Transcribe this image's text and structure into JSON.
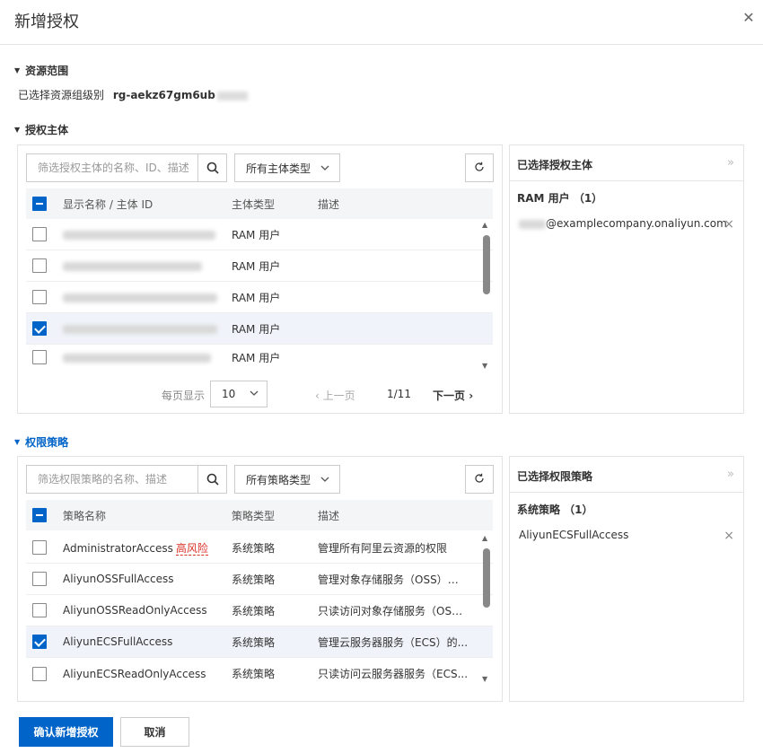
{
  "dialog": {
    "title": "新增授权"
  },
  "resource": {
    "section_title": "资源范围",
    "label": "已选择资源组级别",
    "value": "rg-aekz67gm6ub"
  },
  "principal": {
    "section_title": "授权主体",
    "search_placeholder": "筛选授权主体的名称、ID、描述",
    "type_select": "所有主体类型",
    "columns": [
      "显示名称 / 主体 ID",
      "主体类型",
      "描述"
    ],
    "rows": [
      {
        "type": "RAM 用户",
        "selected": false
      },
      {
        "type": "RAM 用户",
        "selected": false
      },
      {
        "type": "RAM 用户",
        "selected": false
      },
      {
        "type": "RAM 用户",
        "selected": true
      },
      {
        "type": "RAM 用户",
        "selected": false
      }
    ],
    "pager": {
      "page_size_label": "每页显示",
      "page_size": "10",
      "prev": "上一页",
      "count": "1/11",
      "next": "下一页"
    },
    "selected_panel": {
      "title": "已选择授权主体",
      "group": "RAM 用户 （1）",
      "item": "@examplecompany.onaliyun.com"
    }
  },
  "policy": {
    "section_title": "权限策略",
    "search_placeholder": "筛选权限策略的名称、描述",
    "type_select": "所有策略类型",
    "columns": [
      "策略名称",
      "策略类型",
      "描述"
    ],
    "risk_tag": "高风险",
    "rows": [
      {
        "name": "AdministratorAccess",
        "type": "系统策略",
        "desc": "管理所有阿里云资源的权限",
        "selected": false,
        "risk": true
      },
      {
        "name": "AliyunOSSFullAccess",
        "type": "系统策略",
        "desc": "管理对象存储服务（OSS）权限",
        "selected": false
      },
      {
        "name": "AliyunOSSReadOnlyAccess",
        "type": "系统策略",
        "desc": "只读访问对象存储服务（OSS...",
        "selected": false
      },
      {
        "name": "AliyunECSFullAccess",
        "type": "系统策略",
        "desc": "管理云服务器服务（ECS）的...",
        "selected": true
      },
      {
        "name": "AliyunECSReadOnlyAccess",
        "type": "系统策略",
        "desc": "只读访问云服务器服务（ECS...",
        "selected": false
      }
    ],
    "selected_panel": {
      "title": "已选择权限策略",
      "group": "系统策略 （1）",
      "item": "AliyunECSFullAccess"
    }
  },
  "footer": {
    "confirm": "确认新增授权",
    "cancel": "取消"
  },
  "colors": {
    "primary": "#0064c8",
    "risk": "#d93026"
  }
}
